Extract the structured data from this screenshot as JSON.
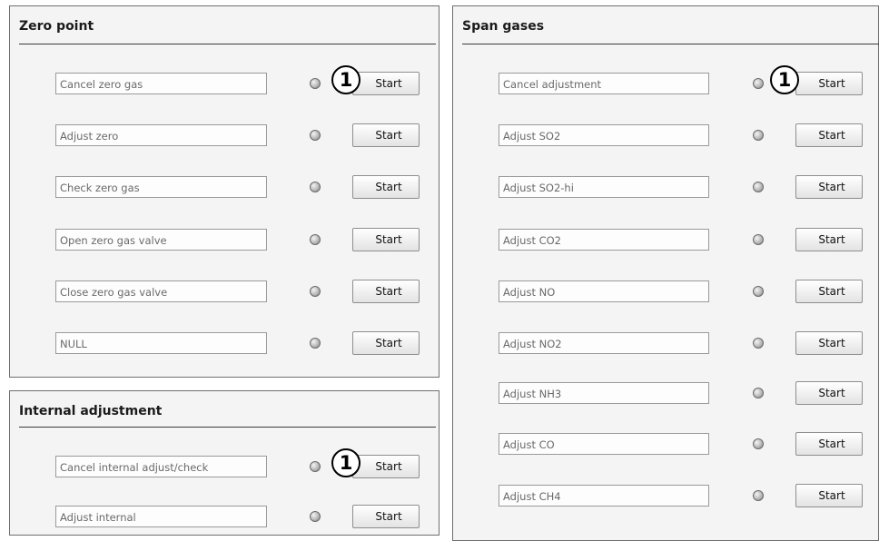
{
  "zero_point": {
    "title": "Zero point",
    "rows": [
      {
        "label": "Cancel zero gas",
        "button": "Start",
        "callout": "1"
      },
      {
        "label": "Adjust zero",
        "button": "Start"
      },
      {
        "label": "Check zero gas",
        "button": "Start"
      },
      {
        "label": "Open zero gas valve",
        "button": "Start"
      },
      {
        "label": "Close zero gas valve",
        "button": "Start"
      },
      {
        "label": "NULL",
        "button": "Start"
      }
    ]
  },
  "internal_adjustment": {
    "title": "Internal adjustment",
    "rows": [
      {
        "label": "Cancel internal adjust/check",
        "button": "Start",
        "callout": "1"
      },
      {
        "label": "Adjust internal",
        "button": "Start"
      }
    ]
  },
  "span_gases": {
    "title": "Span gases",
    "rows": [
      {
        "label": "Cancel adjustment",
        "button": "Start",
        "callout": "1"
      },
      {
        "label": "Adjust SO2",
        "button": "Start"
      },
      {
        "label": "Adjust SO2-hi",
        "button": "Start"
      },
      {
        "label": "Adjust CO2",
        "button": "Start"
      },
      {
        "label": "Adjust NO",
        "button": "Start"
      },
      {
        "label": "Adjust NO2",
        "button": "Start"
      },
      {
        "label": "Adjust NH3",
        "button": "Start"
      },
      {
        "label": "Adjust CO",
        "button": "Start"
      },
      {
        "label": "Adjust CH4",
        "button": "Start"
      }
    ]
  }
}
